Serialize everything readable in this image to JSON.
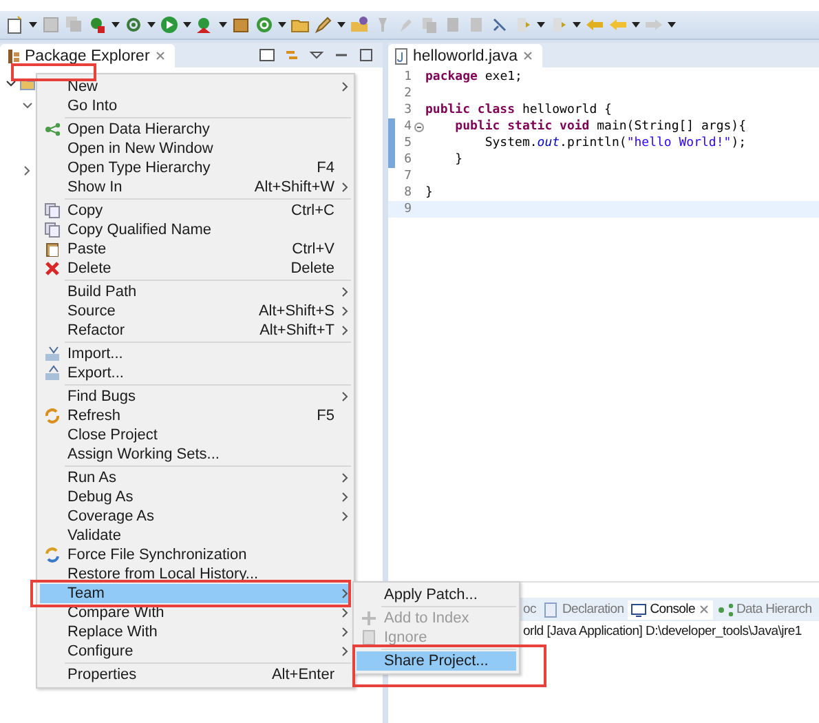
{
  "package_explorer": {
    "title": "Package Explorer"
  },
  "editor": {
    "tab": "helloworld.java",
    "lines": [
      {
        "number": "1",
        "marked": false,
        "current": false,
        "fold": false,
        "tokens": [
          {
            "kind": "keyword",
            "text": "package"
          },
          {
            "kind": "plain",
            "text": " exe1;"
          }
        ]
      },
      {
        "number": "2",
        "marked": false,
        "current": false,
        "fold": false
      },
      {
        "number": "3",
        "marked": false,
        "current": false,
        "fold": false,
        "tokens": [
          {
            "kind": "keyword",
            "text": "public class"
          },
          {
            "kind": "plain",
            "text": " helloworld {"
          }
        ]
      },
      {
        "number": "4",
        "marked": true,
        "current": false,
        "fold": true,
        "tokens": [
          {
            "kind": "keyword",
            "text": "    public static void"
          },
          {
            "kind": "plain",
            "text": " main(String[] args){"
          }
        ]
      },
      {
        "number": "5",
        "marked": true,
        "current": false,
        "fold": false,
        "tokens": [
          {
            "kind": "plain",
            "text": "        System."
          },
          {
            "kind": "field",
            "text": "out"
          },
          {
            "kind": "plain",
            "text": ".println("
          },
          {
            "kind": "string",
            "text": "\"hello World!\""
          },
          {
            "kind": "plain",
            "text": ");"
          }
        ]
      },
      {
        "number": "6",
        "marked": true,
        "current": false,
        "fold": false,
        "tokens": [
          {
            "kind": "plain",
            "text": "    }"
          }
        ]
      },
      {
        "number": "7",
        "marked": false,
        "current": false,
        "fold": false
      },
      {
        "number": "8",
        "marked": false,
        "current": false,
        "fold": false,
        "tokens": [
          {
            "kind": "plain",
            "text": "}"
          }
        ]
      },
      {
        "number": "9",
        "marked": false,
        "current": true,
        "fold": false
      }
    ]
  },
  "bottom_panel": {
    "tabs": [
      {
        "label": "oc",
        "selected": false
      },
      {
        "label": "Declaration",
        "selected": false
      },
      {
        "label": "Console",
        "selected": true
      },
      {
        "label": "Data Hierarch",
        "selected": false
      }
    ],
    "console_line": "orld [Java Application] D:\\developer_tools\\Java\\jre1"
  },
  "context_menu": [
    {
      "kind": "item",
      "label": "New",
      "submenu": true,
      "selected": false
    },
    {
      "kind": "item",
      "label": "Go Into",
      "submenu": false,
      "selected": false
    },
    {
      "kind": "separator"
    },
    {
      "kind": "item",
      "label": "Open Data Hierarchy",
      "submenu": false,
      "selected": false
    },
    {
      "kind": "item",
      "label": "Open in New Window",
      "submenu": false,
      "selected": false
    },
    {
      "kind": "item",
      "label": "Open Type Hierarchy",
      "shortcut": "F4",
      "submenu": false,
      "selected": false
    },
    {
      "kind": "item",
      "label": "Show In",
      "shortcut": "Alt+Shift+W",
      "submenu": true,
      "selected": false
    },
    {
      "kind": "separator"
    },
    {
      "kind": "item",
      "label": "Copy",
      "shortcut": "Ctrl+C",
      "submenu": false,
      "selected": false
    },
    {
      "kind": "item",
      "label": "Copy Qualified Name",
      "submenu": false,
      "selected": false
    },
    {
      "kind": "item",
      "label": "Paste",
      "shortcut": "Ctrl+V",
      "submenu": false,
      "selected": false
    },
    {
      "kind": "item",
      "label": "Delete",
      "shortcut": "Delete",
      "submenu": false,
      "selected": false
    },
    {
      "kind": "separator"
    },
    {
      "kind": "item",
      "label": "Build Path",
      "submenu": true,
      "selected": false
    },
    {
      "kind": "item",
      "label": "Source",
      "shortcut": "Alt+Shift+S",
      "submenu": true,
      "selected": false
    },
    {
      "kind": "item",
      "label": "Refactor",
      "shortcut": "Alt+Shift+T",
      "submenu": true,
      "selected": false
    },
    {
      "kind": "separator"
    },
    {
      "kind": "item",
      "label": "Import...",
      "submenu": false,
      "selected": false
    },
    {
      "kind": "item",
      "label": "Export...",
      "submenu": false,
      "selected": false
    },
    {
      "kind": "separator"
    },
    {
      "kind": "item",
      "label": "Find Bugs",
      "submenu": true,
      "selected": false
    },
    {
      "kind": "item",
      "label": "Refresh",
      "shortcut": "F5",
      "submenu": false,
      "selected": false
    },
    {
      "kind": "item",
      "label": "Close Project",
      "submenu": false,
      "selected": false
    },
    {
      "kind": "item",
      "label": "Assign Working Sets...",
      "submenu": false,
      "selected": false
    },
    {
      "kind": "separator"
    },
    {
      "kind": "item",
      "label": "Run As",
      "submenu": true,
      "selected": false
    },
    {
      "kind": "item",
      "label": "Debug As",
      "submenu": true,
      "selected": false
    },
    {
      "kind": "item",
      "label": "Coverage As",
      "submenu": true,
      "selected": false
    },
    {
      "kind": "item",
      "label": "Validate",
      "submenu": false,
      "selected": false
    },
    {
      "kind": "item",
      "label": "Force File Synchronization",
      "submenu": false,
      "selected": false
    },
    {
      "kind": "item",
      "label": "Restore from Local History...",
      "submenu": false,
      "selected": false
    },
    {
      "kind": "item",
      "label": "Team",
      "submenu": true,
      "selected": true
    },
    {
      "kind": "item",
      "label": "Compare With",
      "submenu": true,
      "selected": false
    },
    {
      "kind": "item",
      "label": "Replace With",
      "submenu": true,
      "selected": false
    },
    {
      "kind": "item",
      "label": "Configure",
      "submenu": true,
      "selected": false
    },
    {
      "kind": "separator"
    },
    {
      "kind": "item",
      "label": "Properties",
      "shortcut": "Alt+Enter",
      "submenu": false,
      "selected": false
    }
  ],
  "team_submenu": [
    {
      "kind": "item",
      "label": "Apply Patch...",
      "disabled": false,
      "selected": false
    },
    {
      "kind": "separator"
    },
    {
      "kind": "item",
      "label": "Add to Index",
      "disabled": true,
      "selected": false
    },
    {
      "kind": "item",
      "label": "Ignore",
      "disabled": true,
      "selected": false
    },
    {
      "kind": "separator"
    },
    {
      "kind": "item",
      "label": "Share Project...",
      "disabled": false,
      "selected": true
    }
  ]
}
